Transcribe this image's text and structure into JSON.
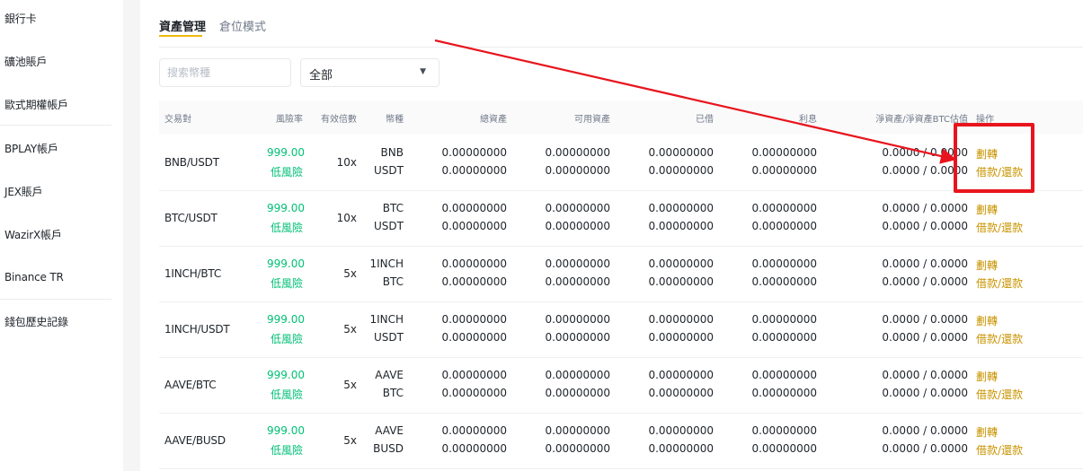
{
  "sidebar": {
    "items": [
      {
        "label": "銀行卡"
      },
      {
        "label": "礦池賬戶"
      },
      {
        "label": "歐式期權帳戶"
      },
      {
        "label": "BPLAY帳戶"
      },
      {
        "label": "JEX賬戶"
      },
      {
        "label": "WazirX帳戶"
      },
      {
        "label": "Binance TR"
      },
      {
        "label": "錢包歷史記錄"
      }
    ]
  },
  "tabs": [
    {
      "label": "資產管理",
      "active": true
    },
    {
      "label": "倉位模式",
      "active": false
    }
  ],
  "filters": {
    "search_placeholder": "搜索幣種",
    "select_value": "全部"
  },
  "table": {
    "headers": {
      "pair": "交易對",
      "risk": "風險率",
      "leverage": "有效倍數",
      "coin": "幣種",
      "total": "總資產",
      "available": "可用資產",
      "borrowed": "已借",
      "interest": "利息",
      "net": "淨資產/淨資產BTC估值",
      "action": "操作"
    },
    "rows": [
      {
        "pair": "BNB/USDT",
        "risk_value": "999.00",
        "risk_level": "低風險",
        "leverage": "10x",
        "coin_a": "BNB",
        "coin_b": "USDT",
        "total_a": "0.00000000",
        "total_b": "0.00000000",
        "avail_a": "0.00000000",
        "avail_b": "0.00000000",
        "borrowed_a": "0.00000000",
        "borrowed_b": "0.00000000",
        "interest_a": "0.00000000",
        "interest_b": "0.00000000",
        "net_a": "0.0000 / 0.0000",
        "net_b": "0.0000 / 0.0000",
        "transfer": "劃轉",
        "borrow": "借款",
        "repay": "還款"
      },
      {
        "pair": "BTC/USDT",
        "risk_value": "999.00",
        "risk_level": "低風險",
        "leverage": "10x",
        "coin_a": "BTC",
        "coin_b": "USDT",
        "total_a": "0.00000000",
        "total_b": "0.00000000",
        "avail_a": "0.00000000",
        "avail_b": "0.00000000",
        "borrowed_a": "0.00000000",
        "borrowed_b": "0.00000000",
        "interest_a": "0.00000000",
        "interest_b": "0.00000000",
        "net_a": "0.0000 / 0.0000",
        "net_b": "0.0000 / 0.0000",
        "transfer": "劃轉",
        "borrow": "借款",
        "repay": "還款"
      },
      {
        "pair": "1INCH/BTC",
        "risk_value": "999.00",
        "risk_level": "低風險",
        "leverage": "5x",
        "coin_a": "1INCH",
        "coin_b": "BTC",
        "total_a": "0.00000000",
        "total_b": "0.00000000",
        "avail_a": "0.00000000",
        "avail_b": "0.00000000",
        "borrowed_a": "0.00000000",
        "borrowed_b": "0.00000000",
        "interest_a": "0.00000000",
        "interest_b": "0.00000000",
        "net_a": "0.0000 / 0.0000",
        "net_b": "0.0000 / 0.0000",
        "transfer": "劃轉",
        "borrow": "借款",
        "repay": "還款"
      },
      {
        "pair": "1INCH/USDT",
        "risk_value": "999.00",
        "risk_level": "低風險",
        "leverage": "5x",
        "coin_a": "1INCH",
        "coin_b": "USDT",
        "total_a": "0.00000000",
        "total_b": "0.00000000",
        "avail_a": "0.00000000",
        "avail_b": "0.00000000",
        "borrowed_a": "0.00000000",
        "borrowed_b": "0.00000000",
        "interest_a": "0.00000000",
        "interest_b": "0.00000000",
        "net_a": "0.0000 / 0.0000",
        "net_b": "0.0000 / 0.0000",
        "transfer": "劃轉",
        "borrow": "借款",
        "repay": "還款"
      },
      {
        "pair": "AAVE/BTC",
        "risk_value": "999.00",
        "risk_level": "低風險",
        "leverage": "5x",
        "coin_a": "AAVE",
        "coin_b": "BTC",
        "total_a": "0.00000000",
        "total_b": "0.00000000",
        "avail_a": "0.00000000",
        "avail_b": "0.00000000",
        "borrowed_a": "0.00000000",
        "borrowed_b": "0.00000000",
        "interest_a": "0.00000000",
        "interest_b": "0.00000000",
        "net_a": "0.0000 / 0.0000",
        "net_b": "0.0000 / 0.0000",
        "transfer": "劃轉",
        "borrow": "借款",
        "repay": "還款"
      },
      {
        "pair": "AAVE/BUSD",
        "risk_value": "999.00",
        "risk_level": "低風險",
        "leverage": "5x",
        "coin_a": "AAVE",
        "coin_b": "BUSD",
        "total_a": "0.00000000",
        "total_b": "0.00000000",
        "avail_a": "0.00000000",
        "avail_b": "0.00000000",
        "borrowed_a": "0.00000000",
        "borrowed_b": "0.00000000",
        "interest_a": "0.00000000",
        "interest_b": "0.00000000",
        "net_a": "0.0000 / 0.0000",
        "net_b": "0.0000 / 0.0000",
        "transfer": "劃轉",
        "borrow": "借款",
        "repay": "還款"
      }
    ]
  },
  "icons": {
    "select_caret": "chevron-down-icon"
  },
  "colors": {
    "accent": "#f0b90b",
    "action_text": "#c99400",
    "low_risk": "#02c076",
    "annotation_red": "#e8141d"
  }
}
